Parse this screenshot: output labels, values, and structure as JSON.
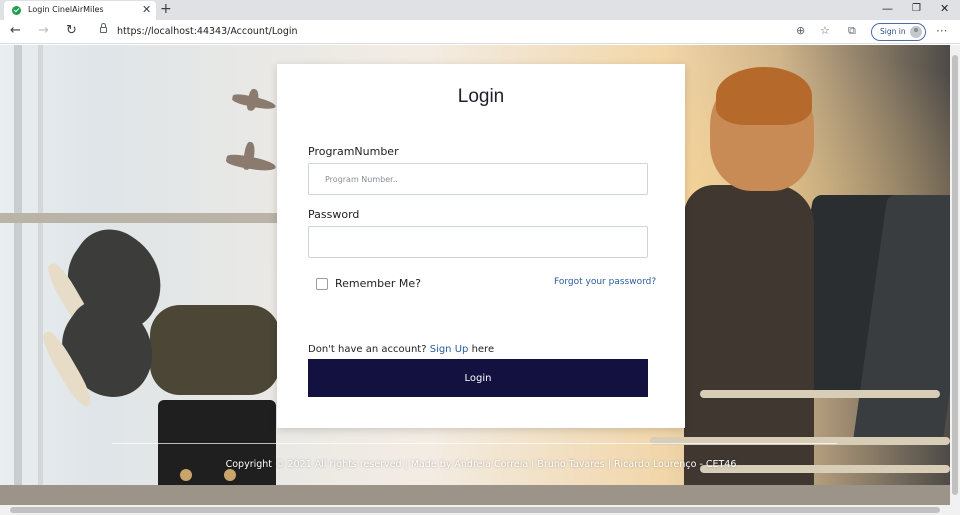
{
  "browser": {
    "tab_title": "Login CinelAirMiles",
    "tab_close": "✕",
    "new_tab": "+",
    "url": "https://localhost:44343/Account/Login",
    "sign_in_label": "Sign in",
    "window_controls": {
      "minimize": "—",
      "maximize": "❐",
      "close": "✕"
    },
    "nav": {
      "back": "←",
      "forward": "→",
      "reload": "↻",
      "more": "···",
      "read_aloud": "⊕",
      "favorite": "☆",
      "collections": "⧉"
    }
  },
  "login": {
    "title": "Login",
    "program_number_label": "ProgramNumber",
    "program_number_placeholder": "Program Number..",
    "program_number_value": "",
    "password_label": "Password",
    "password_value": "",
    "remember_label": "Remember Me?",
    "remember_checked": false,
    "forgot_link": "Forgot your password?",
    "no_account_prefix": "Don't have an account?",
    "signup_link": "Sign Up",
    "no_account_suffix": "here",
    "submit_label": "Login"
  },
  "footer": {
    "text": "Copyright © 2021 All rights reserved | Made by Andreia Correia | Bruno Tavares | Ricardo Lourenço - CET46"
  },
  "colors": {
    "button_bg": "#13113f",
    "link": "#2a5d9f",
    "favicon": "#1e9e4a"
  }
}
